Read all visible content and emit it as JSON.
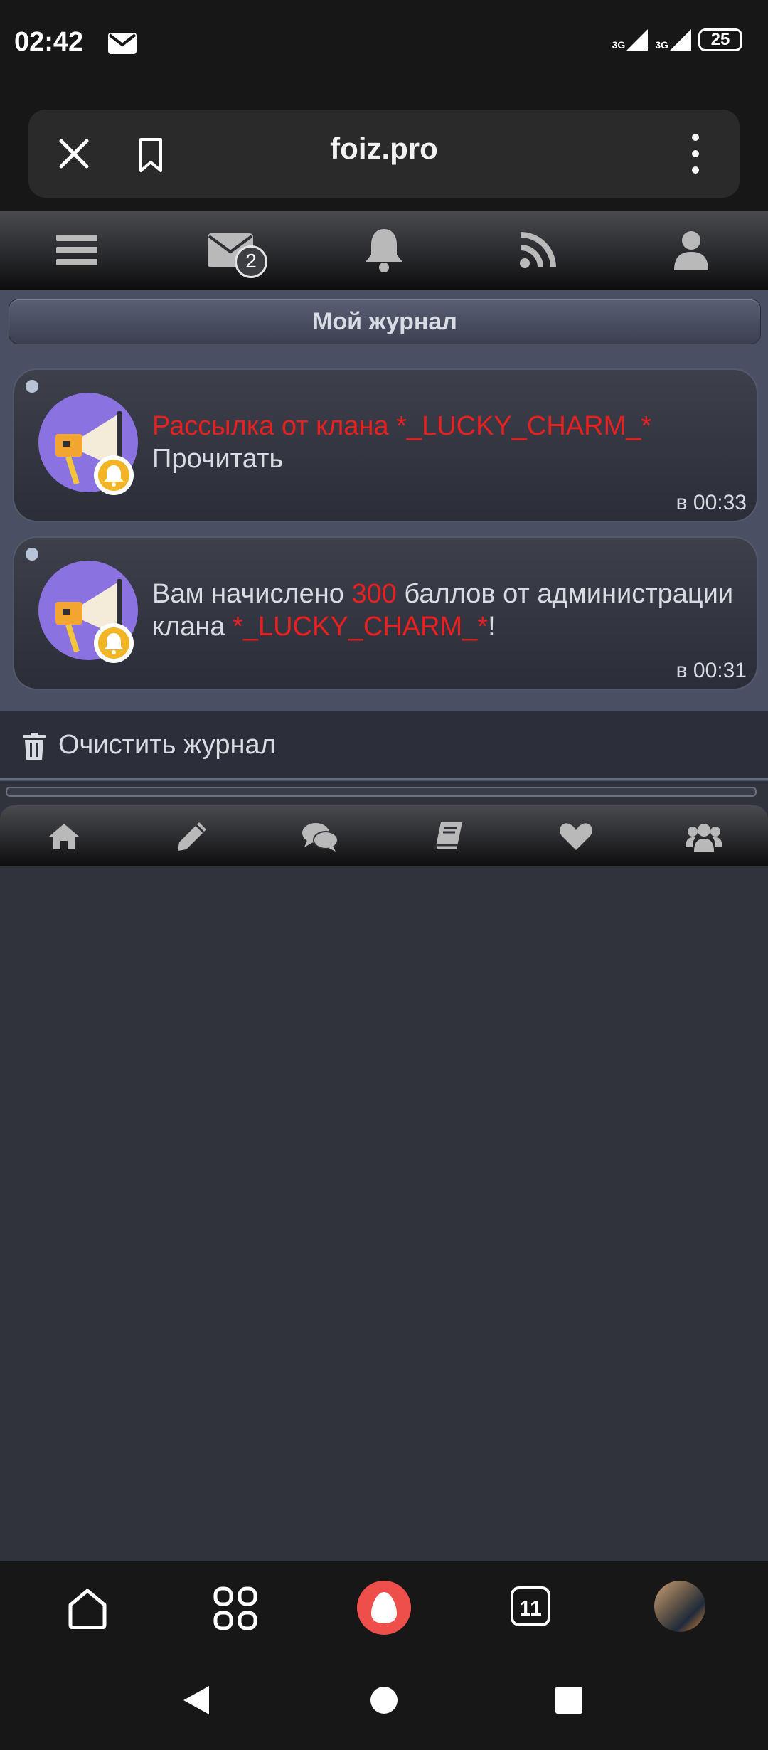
{
  "status_bar": {
    "time": "02:42",
    "network1": "3G",
    "network2": "3G",
    "battery": "25"
  },
  "browser": {
    "url": "foiz.pro",
    "tabs_count": "11"
  },
  "site_nav": {
    "mail_badge": "2"
  },
  "journal": {
    "title": "Мой журнал",
    "entries": [
      {
        "line1_red": "Рассылка от клана *_LUCKY_CHARM_*",
        "line2": "Прочитать",
        "time": "в 00:33"
      },
      {
        "t1": "Вам начислено ",
        "points": "300",
        "t2": " баллов от администрации клана ",
        "clan": "*_LUCKY_CHARM_*",
        "t3": "!",
        "time": "в 00:31"
      }
    ],
    "clear_label": "Очистить журнал"
  },
  "colors": {
    "accent_red": "#ea1f1f",
    "page_bg": "#30333c",
    "alice": "#ee4f4a"
  }
}
